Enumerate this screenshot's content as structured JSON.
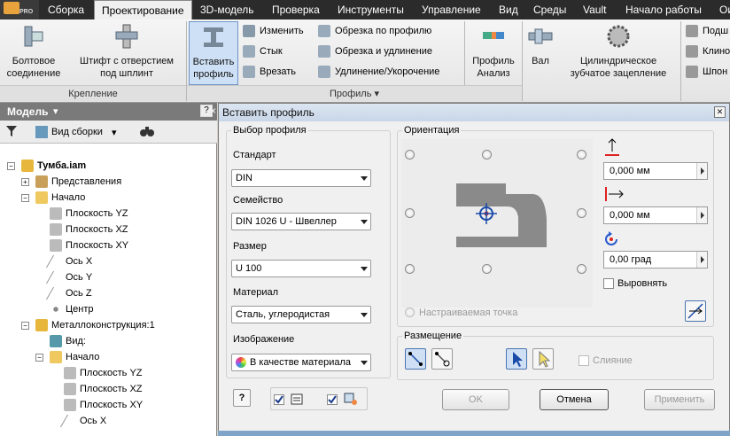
{
  "app": {
    "badge": "PRO"
  },
  "tabs": [
    "Сборка",
    "Проектирование",
    "3D-модель",
    "Проверка",
    "Инструменты",
    "Управление",
    "Вид",
    "Среды",
    "Vault",
    "Начало работы",
    "Ои"
  ],
  "active_tab": "Проектирование",
  "ribbon": {
    "bolt": "Болтовое\nсоединение",
    "pin": "Штифт с отверстием\nпод шплинт",
    "insert_profile": "Вставить\nпрофиль",
    "edit": "Изменить",
    "joint": "Стык",
    "cut": "Врезать",
    "trim_profile": "Обрезка по профилю",
    "trim_extend": "Обрезка и удлинение",
    "lengthen": "Удлинение/Укорочение",
    "profile_analysis": "Профиль\nАнализ",
    "shaft": "Вал",
    "spur_gear": "Цилиндрическое\nзубчатое зацепление",
    "bearing": "Подш",
    "key": "Клино",
    "spline": "Шпон",
    "panel_fastening": "Крепление",
    "panel_profile": "Профиль"
  },
  "browser": {
    "title": "Модель",
    "view_label": "Вид сборки",
    "tree": [
      {
        "label": "Тумба.iam",
        "bold": true
      },
      {
        "label": "Представления"
      },
      {
        "label": "Начало"
      },
      {
        "label": "Плоскость YZ"
      },
      {
        "label": "Плоскость XZ"
      },
      {
        "label": "Плоскость XY"
      },
      {
        "label": "Ось X"
      },
      {
        "label": "Ось Y"
      },
      {
        "label": "Ось Z"
      },
      {
        "label": "Центр"
      },
      {
        "label": "Металлоконструкция:1"
      },
      {
        "label": "Вид:"
      },
      {
        "label": "Начало"
      },
      {
        "label": "Плоскость YZ"
      },
      {
        "label": "Плоскость XZ"
      },
      {
        "label": "Плоскость XY"
      },
      {
        "label": "Ось X"
      }
    ]
  },
  "dialog": {
    "title": "Вставить профиль",
    "profile_selection": "Выбор профиля",
    "standard_label": "Стандарт",
    "standard_value": "DIN",
    "family_label": "Семейство",
    "family_value": "DIN 1026 U - Швеллер",
    "size_label": "Размер",
    "size_value": "U 100",
    "material_label": "Материал",
    "material_value": "Сталь, углеродистая",
    "appearance_label": "Изображение",
    "appearance_value": "В качестве материала",
    "orientation": "Ориентация",
    "offset_y": "0,000 мм",
    "offset_x": "0,000 мм",
    "rotation": "0,00 град",
    "align": "Выровнять",
    "custom_point": "Настраиваемая точка",
    "placement": "Размещение",
    "merge": "Слияние",
    "ok": "OK",
    "cancel": "Отмена",
    "apply": "Применить"
  },
  "colors": {
    "accent": "#4a74b0",
    "tabbar": "#2b2b2b"
  }
}
